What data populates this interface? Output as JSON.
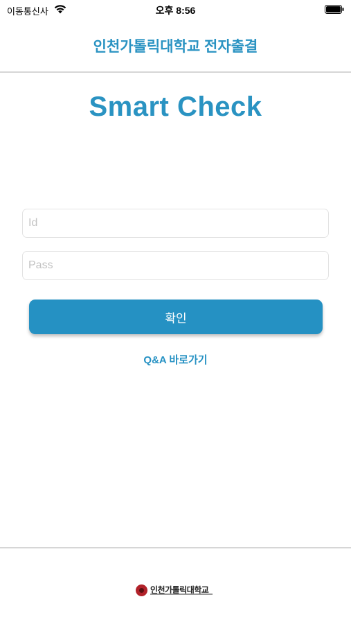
{
  "status_bar": {
    "carrier": "이동통신사",
    "time": "오후 8:56",
    "wifi_icon": "wifi-icon",
    "battery_icon": "battery-icon"
  },
  "header": {
    "title": "인천가톨릭대학교 전자출결"
  },
  "main": {
    "app_title": "Smart Check",
    "id_placeholder": "Id",
    "pass_placeholder": "Pass",
    "confirm_label": "확인",
    "qa_link": "Q&A 바로가기"
  },
  "footer": {
    "logo_text": "인천가톨릭대학교"
  },
  "colors": {
    "accent": "#2591c3",
    "header_text": "#2a93c2",
    "divider": "#d6d6d6"
  }
}
